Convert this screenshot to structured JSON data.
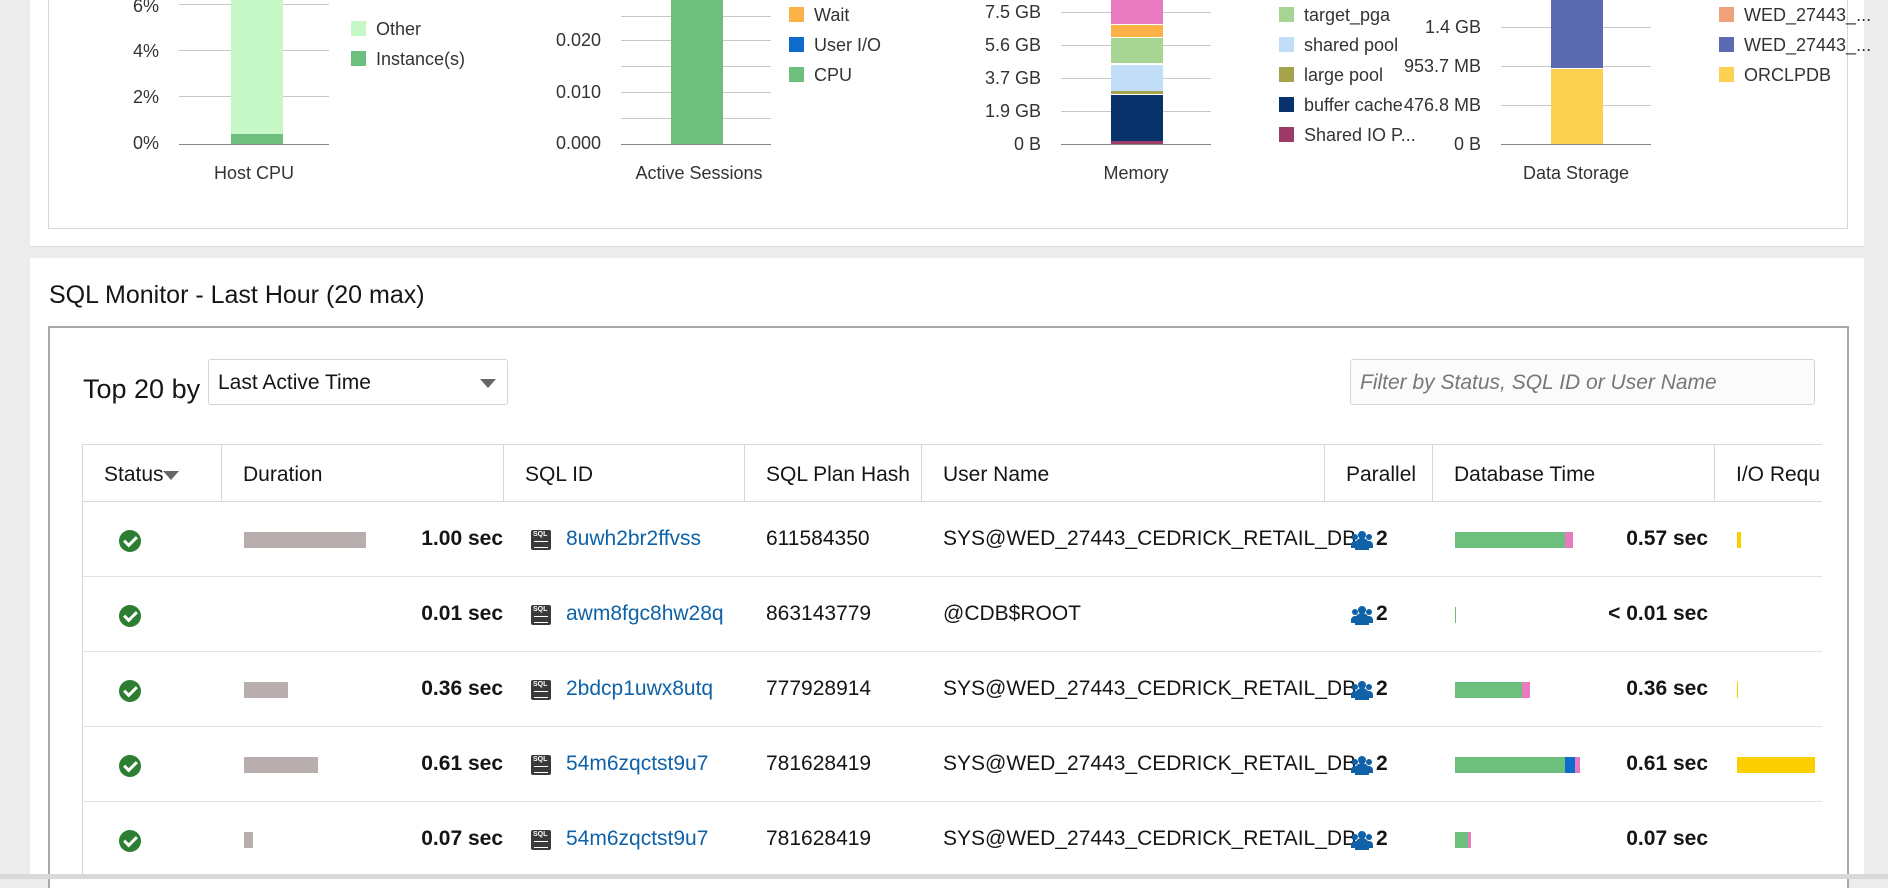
{
  "charts": {
    "host_cpu": {
      "title": "Host CPU",
      "yticks": [
        "6%",
        "4%",
        "2%",
        "0%"
      ],
      "legend": [
        "Other",
        "Instance(s)"
      ],
      "colors": {
        "other": "#c6f7c6",
        "instance": "#6cbf7d"
      }
    },
    "active_sessions": {
      "title": "Active Sessions",
      "yticks": [
        "0.020",
        "0.010",
        "0.000"
      ],
      "legend": [
        "Wait",
        "User I/O",
        "CPU"
      ],
      "colors": {
        "wait": "#fbb247",
        "user_io": "#0f6bcb",
        "cpu": "#6cbf7d"
      }
    },
    "memory": {
      "title": "Memory",
      "yticks": [
        "7.5 GB",
        "5.6 GB",
        "3.7 GB",
        "1.9 GB",
        "0 B"
      ],
      "legend": [
        "target_pga",
        "shared pool",
        "large pool",
        "buffer cache",
        "Shared IO P..."
      ],
      "colors": {
        "pink": "#e87bbf",
        "orange": "#fbb247",
        "target_pga": "#a6d493",
        "shared_pool": "#c1ddf7",
        "large_pool": "#a5a44c",
        "buffer_cache": "#06316b",
        "shared_io": "#9c3a68"
      }
    },
    "data_storage": {
      "title": "Data Storage",
      "yticks": [
        "1.4 GB",
        "953.7 MB",
        "476.8 MB",
        "0 B"
      ],
      "legend": [
        "WED_27443_...",
        "WED_27443_...",
        "ORCLPDB"
      ],
      "colors": {
        "wed1": "#f0a07b",
        "wed2": "#5c6ab1",
        "orclpdb": "#fcd152"
      }
    }
  },
  "sql_monitor": {
    "title": "SQL Monitor - Last Hour (20 max)",
    "top_by_label": "Top 20 by",
    "top_by_value": "Last Active Time",
    "filter_placeholder": "Filter by Status, SQL ID or User Name",
    "columns": [
      "Status",
      "Duration",
      "SQL ID",
      "SQL Plan Hash",
      "User Name",
      "Parallel",
      "Database Time",
      "I/O Requ"
    ],
    "rows": [
      {
        "status": "done",
        "duration_bar_fraction": 1.0,
        "duration": "1.00 sec",
        "sql_id": "8uwh2br2ffvss",
        "plan_hash": "611584350",
        "user": "SYS@WED_27443_CEDRICK_RETAIL_DB",
        "parallel": "2",
        "db_time": "0.57 sec",
        "dbtime_cpu_fraction": 0.86,
        "dbtime_io_fraction": 0.0,
        "dbtime_other_fraction": 0.06,
        "io_fraction": 0.05
      },
      {
        "status": "done",
        "duration_bar_fraction": 0.0,
        "duration": "0.01 sec",
        "sql_id": "awm8fgc8hw28q",
        "plan_hash": "863143779",
        "user": "@CDB$ROOT",
        "parallel": "2",
        "db_time": "< 0.01 sec",
        "dbtime_cpu_fraction": 0.01,
        "dbtime_io_fraction": 0.0,
        "dbtime_other_fraction": 0.0,
        "io_fraction": 0.0
      },
      {
        "status": "done",
        "duration_bar_fraction": 0.36,
        "duration": "0.36 sec",
        "sql_id": "2bdcp1uwx8utq",
        "plan_hash": "777928914",
        "user": "SYS@WED_27443_CEDRICK_RETAIL_DB",
        "parallel": "2",
        "db_time": "0.36 sec",
        "dbtime_cpu_fraction": 0.52,
        "dbtime_io_fraction": 0.0,
        "dbtime_other_fraction": 0.06,
        "io_fraction": 0.01
      },
      {
        "status": "done",
        "duration_bar_fraction": 0.61,
        "duration": "0.61 sec",
        "sql_id": "54m6zqctst9u7",
        "plan_hash": "781628419",
        "user": "SYS@WED_27443_CEDRICK_RETAIL_DB",
        "parallel": "2",
        "db_time": "0.61 sec",
        "dbtime_cpu_fraction": 0.86,
        "dbtime_io_fraction": 0.08,
        "dbtime_other_fraction": 0.04,
        "io_fraction": 1.0
      },
      {
        "status": "done",
        "duration_bar_fraction": 0.07,
        "duration": "0.07 sec",
        "sql_id": "54m6zqctst9u7",
        "plan_hash": "781628419",
        "user": "SYS@WED_27443_CEDRICK_RETAIL_DB",
        "parallel": "2",
        "db_time": "0.07 sec",
        "dbtime_cpu_fraction": 0.1,
        "dbtime_io_fraction": 0.0,
        "dbtime_other_fraction": 0.02,
        "io_fraction": 0.0
      }
    ]
  },
  "colors": {
    "cpu": "#6cbf7d",
    "io": "#0f6bcb",
    "other": "#e87bbf",
    "duration": "#b9aeae",
    "io_req": "#fbce00",
    "ok": "#2d7d32",
    "link": "#0f62a8"
  }
}
